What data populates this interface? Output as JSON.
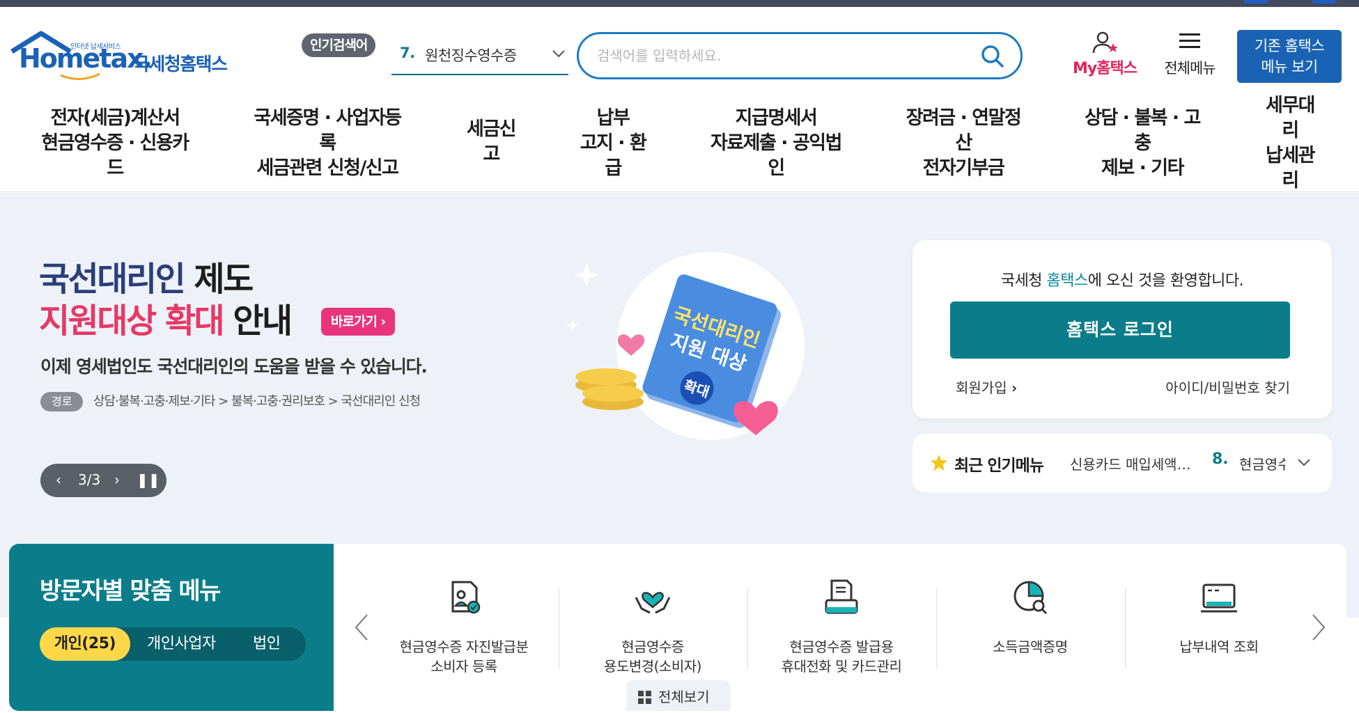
{
  "header": {
    "logo_small": "인터넷 납세서비스",
    "logo_word": "Hometax.",
    "logo_kr": "국세청홈택스",
    "popular_badge": "인기검색어",
    "popular_rank": "7.",
    "popular_keyword": "원천징수영수증",
    "search_placeholder": "검색어를 입력하세요.",
    "my_hometax": "My홈택스",
    "all_menu": "전체메뉴",
    "legacy_menu_line1": "기존 홈택스",
    "legacy_menu_line2": "메뉴 보기"
  },
  "gnb": {
    "items": [
      {
        "l1": "전자(세금)계산서",
        "l2": "현금영수증 · 신용카",
        "l3": "드"
      },
      {
        "l1": "국세증명 · 사업자등",
        "l2": "록",
        "l3": "세금관련 신청/신고"
      },
      {
        "l1": "세금신",
        "l2": "고",
        "l3": ""
      },
      {
        "l1": "납부",
        "l2": "고지 · 환",
        "l3": "급"
      },
      {
        "l1": "지급명세서",
        "l2": "자료제출 · 공익법",
        "l3": "인"
      },
      {
        "l1": "장려금 · 연말정",
        "l2": "산",
        "l3": "전자기부금"
      },
      {
        "l1": "상담 · 불복 · 고",
        "l2": "충",
        "l3": "제보 · 기타"
      },
      {
        "l1": "세무대",
        "l2": "리",
        "l3": "납세관",
        "l4": "리"
      }
    ]
  },
  "hero": {
    "title_part1": "국선대리인",
    "title_part2": " 제도",
    "title_part3": "지원대상 확대",
    "title_part4": " 안내",
    "go_button": "바로가기",
    "description": "이제 영세법인도 국선대리인의 도움을 받을 수 있습니다.",
    "path_badge": "경로",
    "path_text": "상담·불복·고충·제보·기타 > 불복·고충·권리보호 > 국선대리인 신청",
    "pager": "3/3",
    "art_line1": "국선대리인",
    "art_line2": "지원 대상",
    "art_badge": "확대"
  },
  "login": {
    "welcome_before": "국세청 ",
    "welcome_hl": "홈택스",
    "welcome_after": "에 오신 것을 환영합니다.",
    "login_button": "홈택스 로그인",
    "join": "회원가입",
    "find": "아이디/비밀번호 찾기"
  },
  "recent": {
    "title": "최근 인기메뉴",
    "menu1": "신용카드 매입세액공제",
    "rank": "8.",
    "menu2": "현금영수증"
  },
  "visitor": {
    "title": "방문자별 맞춤 메뉴",
    "tabs": [
      "개인(25)",
      "개인사업자",
      "법인"
    ]
  },
  "quick_menu": {
    "items": [
      {
        "l1": "현금영수증 자진발급분",
        "l2": "소비자 등록",
        "icon": "document-person-icon"
      },
      {
        "l1": "현금영수증",
        "l2": "용도변경(소비자)",
        "icon": "heart-hands-icon"
      },
      {
        "l1": "현금영수증 발급용",
        "l2": "휴대전화 및 카드관리",
        "icon": "card-document-icon"
      },
      {
        "l1": "소득금액증명",
        "l2": "",
        "icon": "pie-search-icon"
      },
      {
        "l1": "납부내역 조회",
        "l2": "",
        "icon": "monitor-icon"
      }
    ],
    "view_all": "전체보기"
  },
  "colors": {
    "teal": "#0b7d8a",
    "navy_blue": "#1a63b4",
    "pink": "#e53965",
    "hero_bg": "#eef2f8",
    "yellow": "#ffd84a"
  }
}
